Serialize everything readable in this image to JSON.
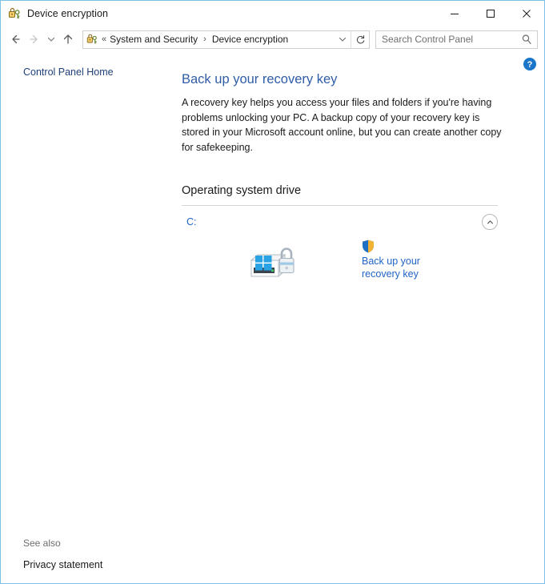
{
  "window": {
    "title": "Device encryption",
    "title_icon": "bitlocker-lock-key-icon",
    "controls": {
      "minimize": "minimize-icon",
      "maximize": "maximize-icon",
      "close": "close-icon"
    }
  },
  "nav": {
    "back": "back-arrow-icon",
    "forward": "forward-arrow-icon",
    "recent": "chevron-down-icon",
    "up": "up-arrow-icon",
    "refresh": "refresh-icon",
    "dropdown": "chevron-down-icon",
    "address_icon": "bitlocker-lock-key-icon",
    "chevrons": "«",
    "separator": "›",
    "breadcrumbs": [
      {
        "label": "System and Security"
      },
      {
        "label": "Device encryption"
      }
    ]
  },
  "search": {
    "placeholder": "Search Control Panel",
    "value": "",
    "icon": "search-icon"
  },
  "sidebar": {
    "home_link": "Control Panel Home",
    "see_also_title": "See also",
    "see_also_links": [
      {
        "label": "Privacy statement"
      }
    ]
  },
  "help": {
    "icon": "help-question-icon",
    "tooltip": "Help"
  },
  "main": {
    "heading": "Back up your recovery key",
    "description": "A recovery key helps you access your files and folders if you're having problems unlocking your PC. A backup copy of your recovery key is stored in your Microsoft account online, but you can create another copy for safekeeping.",
    "section": {
      "title": "Operating system drive",
      "drive": {
        "label": "C:",
        "collapse_icon": "chevron-up-circle-icon",
        "drive_icon": "windows-drive-unlocked-icon",
        "actions": [
          {
            "icon": "uac-shield-icon",
            "label": "Back up your recovery key"
          }
        ]
      }
    }
  },
  "colors": {
    "window_border": "#7fc0e8",
    "heading_blue": "#2f5ca6",
    "link_blue": "#1f64c8",
    "sidebar_link": "#1f3f7a",
    "text": "#1a1a1a",
    "muted": "#6d6d6d",
    "rule": "#d4d4d4",
    "shield_blue": "#1f6fc4",
    "shield_gold": "#f2b233",
    "help_blue": "#1b75c8",
    "windows_logo_blue": "#2aa3e5"
  }
}
